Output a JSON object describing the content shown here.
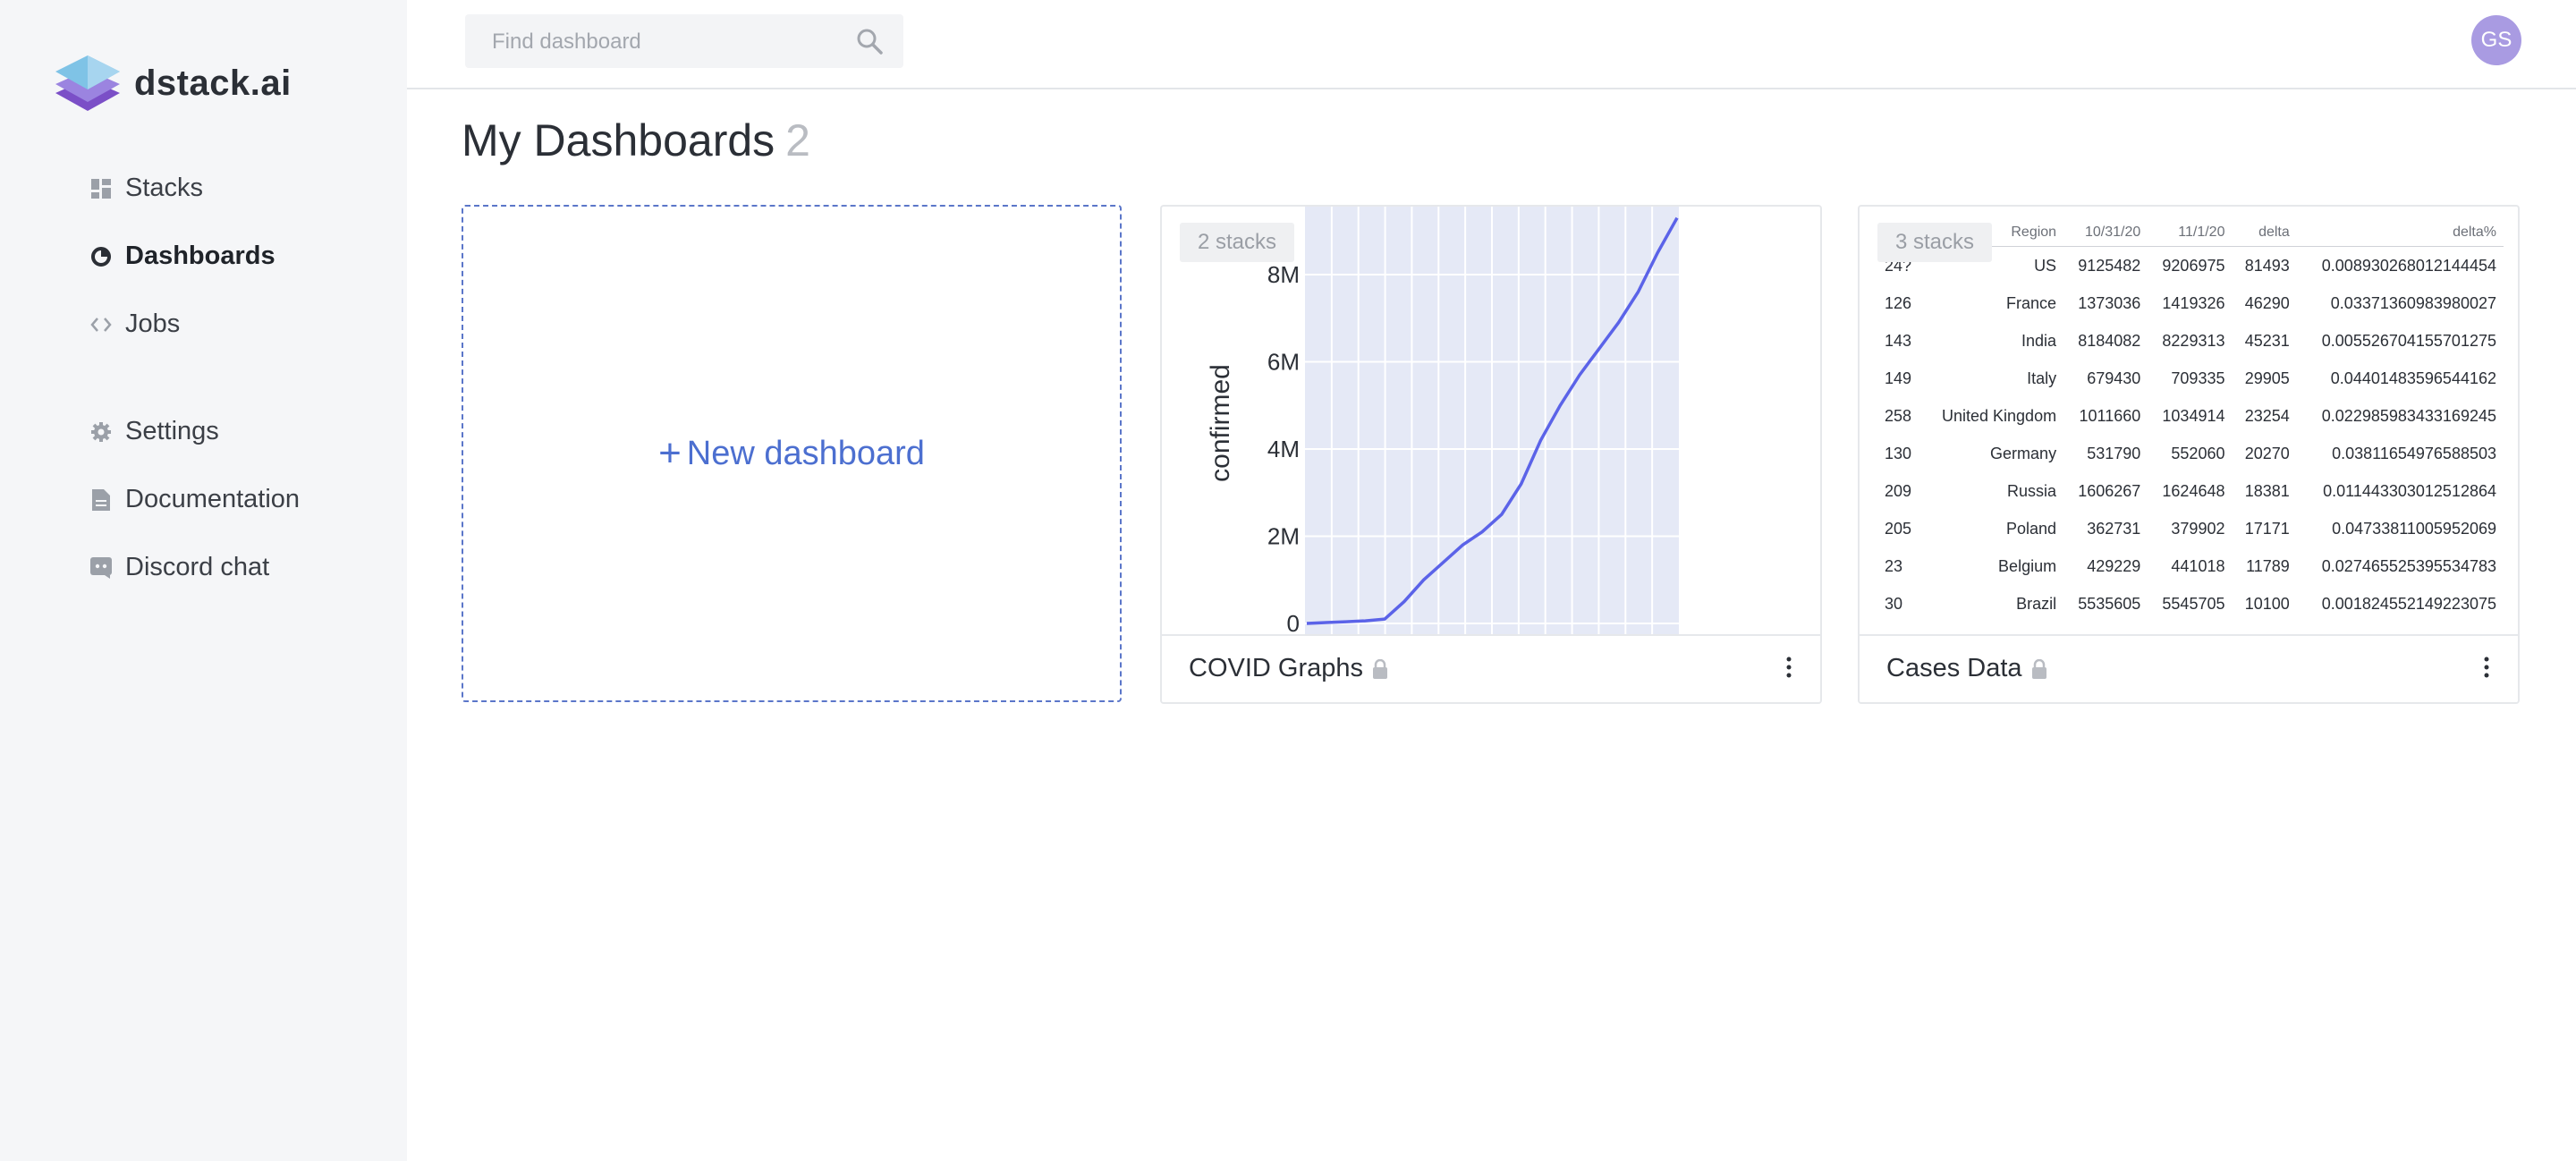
{
  "app": {
    "logo_text": "dstack.ai"
  },
  "sidebar": {
    "items": [
      {
        "label": "Stacks",
        "icon": "stacks-icon"
      },
      {
        "label": "Dashboards",
        "icon": "dashboards-icon",
        "active": true
      },
      {
        "label": "Jobs",
        "icon": "code-icon"
      },
      {
        "label": "Settings",
        "icon": "gear-icon"
      },
      {
        "label": "Documentation",
        "icon": "document-icon"
      },
      {
        "label": "Discord chat",
        "icon": "chat-icon"
      }
    ]
  },
  "header": {
    "search_placeholder": "Find dashboard",
    "avatar_initials": "GS"
  },
  "main": {
    "title": "My Dashboards",
    "count": "2",
    "new_dashboard_label": "New dashboard",
    "cards": [
      {
        "name": "COVID Graphs",
        "stacks_badge": "2 stacks"
      },
      {
        "name": "Cases Data",
        "stacks_badge": "3 stacks"
      }
    ]
  },
  "chart_data": {
    "type": "line",
    "ylabel": "confirmed",
    "yticks": [
      "0",
      "2M",
      "4M",
      "6M",
      "8M"
    ],
    "ylim": [
      0,
      9400000
    ],
    "grid": true,
    "series": [
      {
        "values": [
          0,
          20000,
          40000,
          60000,
          100000,
          500000,
          1000000,
          1400000,
          1800000,
          2100000,
          2500000,
          3200000,
          4200000,
          5000000,
          5700000,
          6300000,
          6900000,
          7600000,
          8500000,
          9300000
        ]
      }
    ]
  },
  "table": {
    "columns": [
      "",
      "Region",
      "10/31/20",
      "11/1/20",
      "delta",
      "delta%"
    ],
    "rows": [
      [
        "24?",
        "US",
        "9125482",
        "9206975",
        "81493",
        "0.008930268012144454"
      ],
      [
        "126",
        "France",
        "1373036",
        "1419326",
        "46290",
        "0.03371360983980027"
      ],
      [
        "143",
        "India",
        "8184082",
        "8229313",
        "45231",
        "0.005526704155701275"
      ],
      [
        "149",
        "Italy",
        "679430",
        "709335",
        "29905",
        "0.04401483596544162"
      ],
      [
        "258",
        "United Kingdom",
        "1011660",
        "1034914",
        "23254",
        "0.022985983433169245"
      ],
      [
        "130",
        "Germany",
        "531790",
        "552060",
        "20270",
        "0.03811654976588503"
      ],
      [
        "209",
        "Russia",
        "1606267",
        "1624648",
        "18381",
        "0.011443303012512864"
      ],
      [
        "205",
        "Poland",
        "362731",
        "379902",
        "17171",
        "0.04733811005952069"
      ],
      [
        "23",
        "Belgium",
        "429229",
        "441018",
        "11789",
        "0.027465525395534783"
      ],
      [
        "30",
        "Brazil",
        "5535605",
        "5545705",
        "10100",
        "0.001824552149223075"
      ]
    ]
  },
  "colors": {
    "accent": "#4c6fd0",
    "line": "#5b63e8",
    "plot_bg": "#e5e9f6",
    "avatar": "#a99be2",
    "sidebar_bg": "#f5f6f8"
  }
}
